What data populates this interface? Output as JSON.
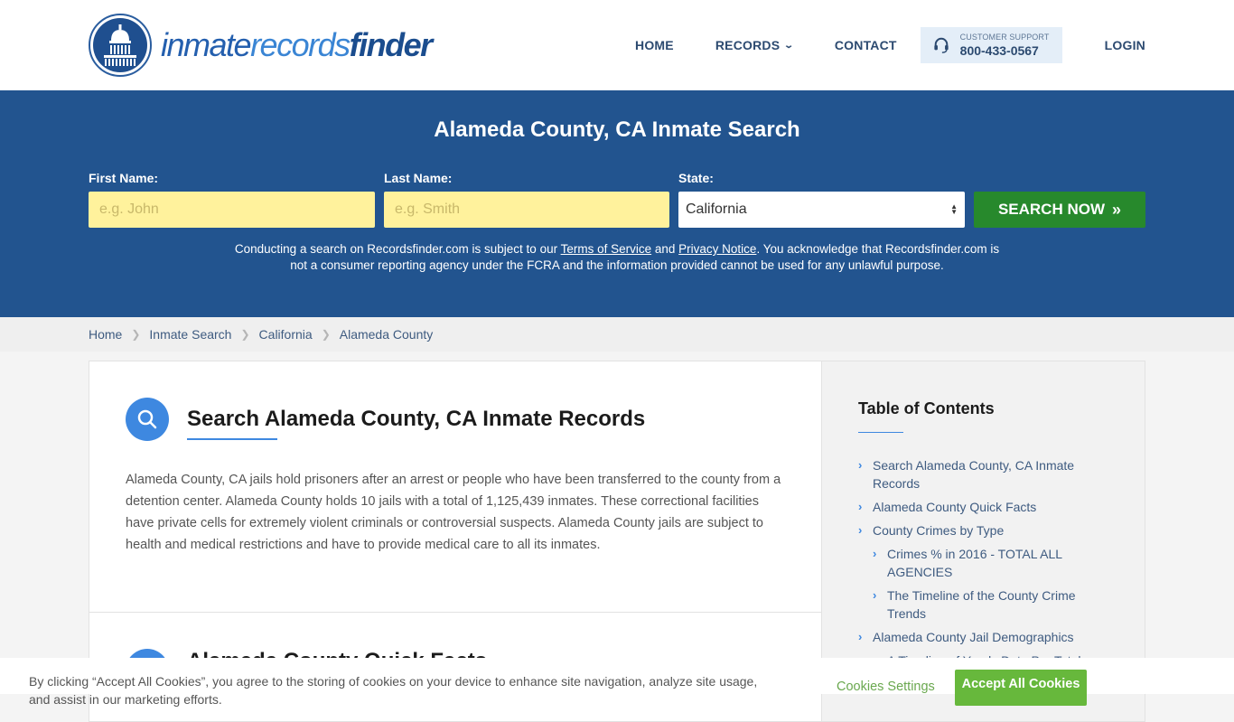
{
  "brand": {
    "logo_part1": "inmate",
    "logo_part2": "records",
    "logo_part3": "finder",
    "logo_icon": "capitol-dome-icon",
    "primary_color": "#22548f",
    "accent_color": "#3e88e0",
    "cta_color": "#27892c"
  },
  "nav": {
    "home": "HOME",
    "records": "RECORDS",
    "contact": "CONTACT",
    "support_label": "CUSTOMER SUPPORT",
    "support_phone": "800-433-0567",
    "support_icon": "headset-icon",
    "login": "LOGIN"
  },
  "hero": {
    "title": "Alameda County, CA Inmate Search",
    "first_name_label": "First Name:",
    "first_name_placeholder": "e.g. John",
    "first_name_value": "",
    "last_name_label": "Last Name:",
    "last_name_placeholder": "e.g. Smith",
    "last_name_value": "",
    "state_label": "State:",
    "state_value": "California",
    "search_button": "SEARCH NOW",
    "search_button_icon": "»",
    "disclaimer_part1": "Conducting a search on Recordsfinder.com is subject to our ",
    "terms_link": "Terms of Service",
    "disclaimer_and": " and ",
    "privacy_link": "Privacy Notice",
    "disclaimer_part2": ". You acknowledge that Recordsfinder.com is not a consumer reporting agency under the FCRA and the information provided cannot be used for any unlawful purpose."
  },
  "breadcrumb": [
    "Home",
    "Inmate Search",
    "California",
    "Alameda County"
  ],
  "content": {
    "section1_title": "Search Alameda County, CA Inmate Records",
    "section1_body": "Alameda County, CA jails hold prisoners after an arrest or people who have been transferred to the county from a detention center. Alameda County holds 10 jails with a total of 1,125,439 inmates. These correctional facilities have private cells for extremely violent criminals or controversial suspects. Alameda County jails are subject to health and medical restrictions and have to provide medical care to all its inmates.",
    "section2_title": "Alameda County Quick Facts"
  },
  "toc": {
    "title": "Table of Contents",
    "items": [
      {
        "label": "Search Alameda County, CA Inmate Records",
        "level": 1
      },
      {
        "label": "Alameda County Quick Facts",
        "level": 1
      },
      {
        "label": "County Crimes by Type",
        "level": 1
      },
      {
        "label": "Crimes % in 2016 - TOTAL ALL AGENCIES",
        "level": 2
      },
      {
        "label": "The Timeline of the County Crime Trends",
        "level": 2
      },
      {
        "label": "Alameda County Jail Demographics",
        "level": 1
      },
      {
        "label": "A Timeline of Yearly Data Per Total",
        "level": 2
      }
    ]
  },
  "cookie": {
    "text": "By clicking “Accept All Cookies”, you agree to the storing of cookies on your device to enhance site navigation, analyze site usage, and assist in our marketing efforts.",
    "settings_button": "Cookies Settings",
    "accept_button": "Accept All Cookies"
  }
}
